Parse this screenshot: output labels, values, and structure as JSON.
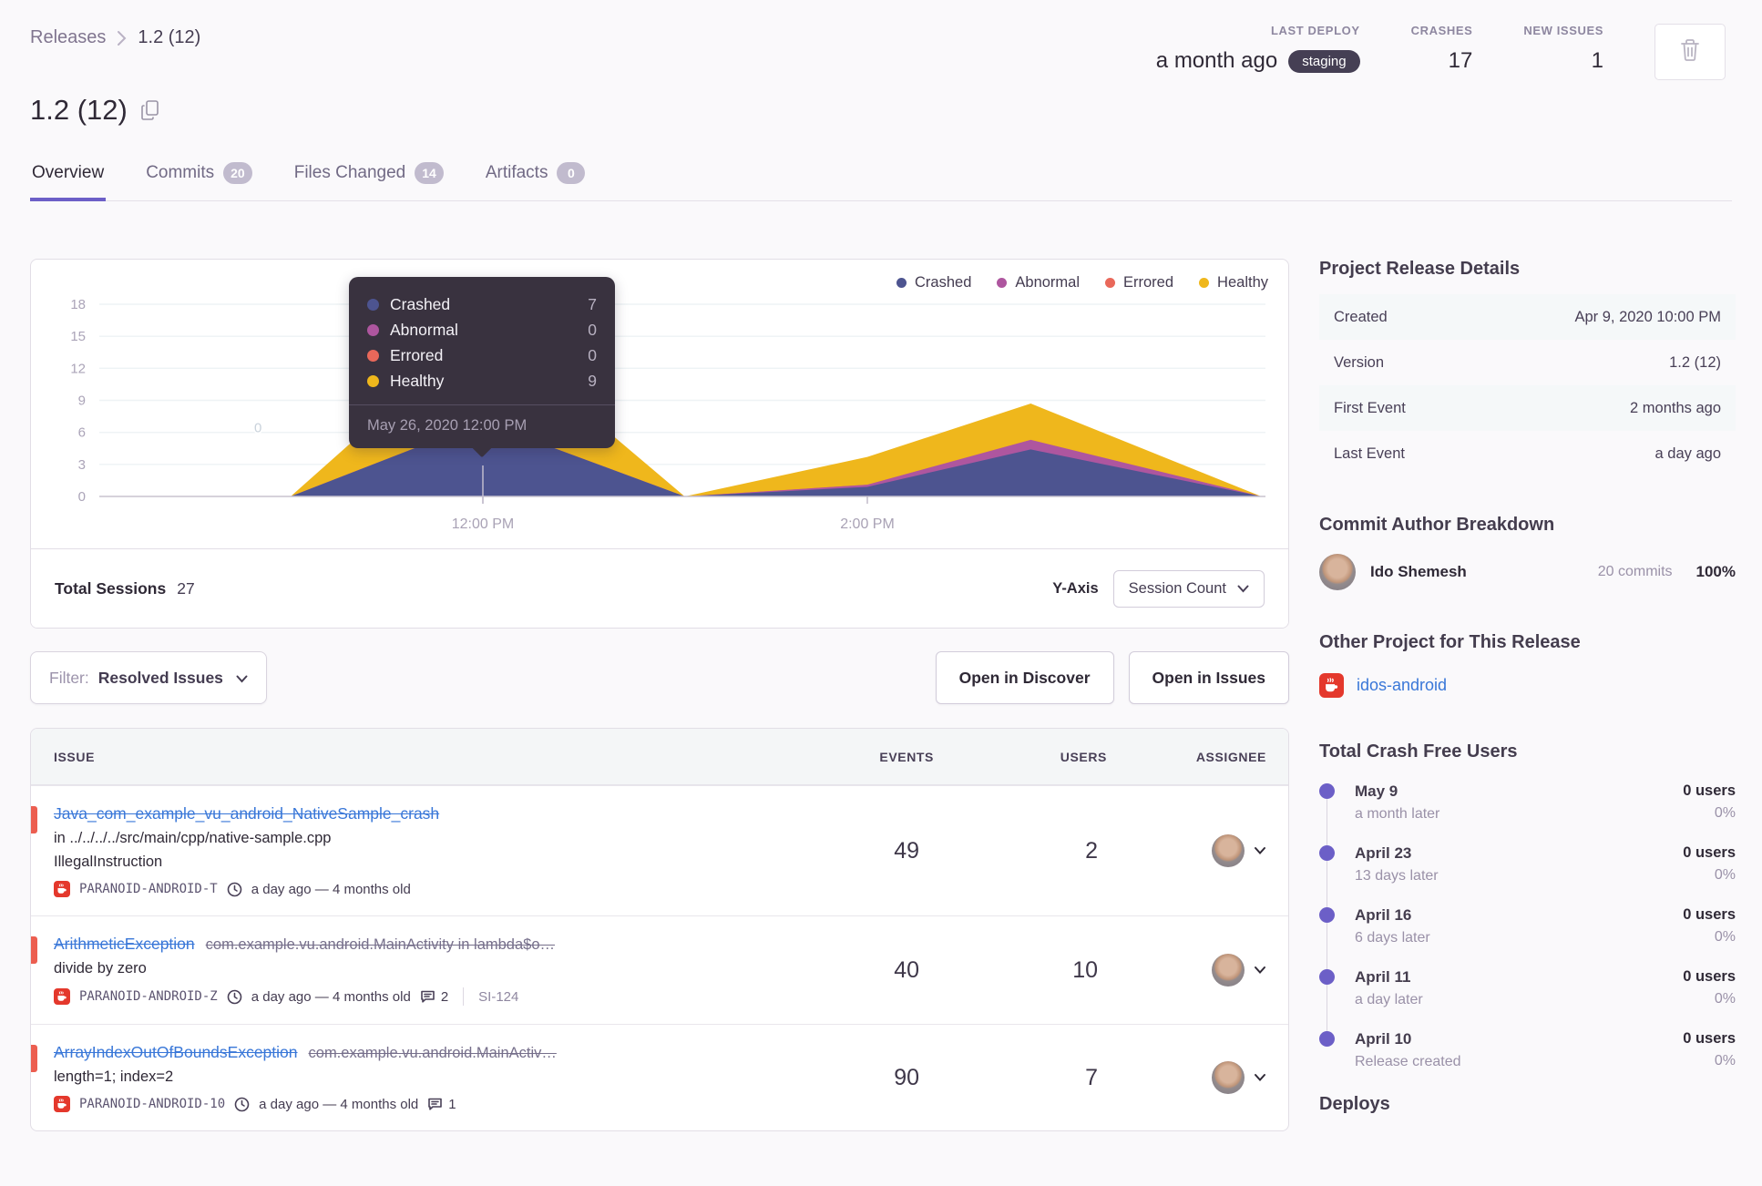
{
  "colors": {
    "accent": "#6C5FC7",
    "link_blue": "#3977D8",
    "unhandled_red": "#EC5E50",
    "env_pill_bg": "#453F54",
    "tooltip_bg": "#39323F",
    "crashed": "#4D5490",
    "abnormal": "#AE569F",
    "errored": "#E9685A",
    "healthy": "#EFB71C"
  },
  "breadcrumb": {
    "root": "Releases",
    "current": "1.2 (12)"
  },
  "header": {
    "title": "1.2 (12)",
    "stats": [
      {
        "label": "LAST DEPLOY",
        "value": "a month ago",
        "pill": "staging"
      },
      {
        "label": "CRASHES",
        "value": "17"
      },
      {
        "label": "NEW ISSUES",
        "value": "1"
      }
    ]
  },
  "tabs": [
    {
      "label": "Overview",
      "active": true
    },
    {
      "label": "Commits",
      "badge": "20"
    },
    {
      "label": "Files Changed",
      "badge": "14"
    },
    {
      "label": "Artifacts",
      "badge": "0"
    }
  ],
  "chart_data": {
    "type": "area",
    "stacked": true,
    "title": "Release session health over time",
    "x_unit": "hour of day (May 26, 2020)",
    "xticks": [
      {
        "label": "12:00 PM",
        "hour": 12
      },
      {
        "label": "2:00 PM",
        "hour": 14
      }
    ],
    "yticks": [
      0,
      3,
      6,
      9,
      12,
      15,
      18
    ],
    "ylim": [
      0,
      18
    ],
    "grid": true,
    "legend_position": "top-right",
    "x_hours": [
      10,
      11,
      12,
      13.05,
      14,
      14.85,
      16.05
    ],
    "series": [
      {
        "name": "Crashed",
        "color": "#4D5490",
        "values": [
          0,
          0,
          7,
          0,
          0.9,
          4.4,
          0
        ]
      },
      {
        "name": "Abnormal",
        "color": "#AE569F",
        "values": [
          0,
          0,
          0,
          0,
          0.2,
          0.9,
          0
        ]
      },
      {
        "name": "Errored",
        "color": "#E9685A",
        "values": [
          0,
          0,
          0,
          0,
          0,
          0,
          0
        ]
      },
      {
        "name": "Healthy",
        "color": "#EFB71C",
        "values": [
          0,
          0,
          9,
          0,
          2.6,
          3.4,
          0
        ]
      }
    ],
    "annotations": [
      {
        "text": "0",
        "hour": 10.83,
        "value": 6.0
      }
    ]
  },
  "chart_card": {
    "tooltip": {
      "rows": [
        {
          "name": "Crashed",
          "value": "7",
          "color": "#4D5490"
        },
        {
          "name": "Abnormal",
          "value": "0",
          "color": "#AE569F"
        },
        {
          "name": "Errored",
          "value": "0",
          "color": "#E9685A"
        },
        {
          "name": "Healthy",
          "value": "9",
          "color": "#EFB71C"
        }
      ],
      "date": "May 26, 2020 12:00 PM"
    },
    "total_sessions_label": "Total Sessions",
    "total_sessions_value": "27",
    "yaxis_label": "Y-Axis",
    "yaxis_value": "Session Count"
  },
  "filter": {
    "prefix": "Filter:",
    "value": "Resolved Issues"
  },
  "actions": {
    "discover": "Open in Discover",
    "issues": "Open in Issues"
  },
  "issues": {
    "headers": {
      "issue": "ISSUE",
      "events": "EVENTS",
      "users": "USERS",
      "assignee": "ASSIGNEE"
    },
    "rows": [
      {
        "title": "Java_com_example_vu_android_NativeSample_crash",
        "subtitle1": "in ../../../../src/main/cpp/native-sample.cpp",
        "subtitle2": "IllegalInstruction",
        "project": "PARANOID-ANDROID-T",
        "age": "a day ago — 4 months old",
        "events": "49",
        "users": "2"
      },
      {
        "title": "ArithmeticException",
        "culprit": "com.example.vu.android.MainActivity in lambda$o…",
        "subtitle1": "divide by zero",
        "project": "PARANOID-ANDROID-Z",
        "age": "a day ago — 4 months old",
        "comments": "2",
        "ref": "SI-124",
        "events": "40",
        "users": "10"
      },
      {
        "title": "ArrayIndexOutOfBoundsException",
        "culprit": "com.example.vu.android.MainActiv…",
        "subtitle1": "length=1; index=2",
        "project": "PARANOID-ANDROID-10",
        "age": "a day ago — 4 months old",
        "comments": "1",
        "events": "90",
        "users": "7"
      }
    ]
  },
  "sidebar": {
    "release_details": {
      "heading": "Project Release Details",
      "rows": [
        {
          "label": "Created",
          "value": "Apr 9, 2020 10:00 PM"
        },
        {
          "label": "Version",
          "value": "1.2 (12)"
        },
        {
          "label": "First Event",
          "value": "2 months ago"
        },
        {
          "label": "Last Event",
          "value": "a day ago"
        }
      ]
    },
    "author_breakdown": {
      "heading": "Commit Author Breakdown",
      "name": "Ido Shemesh",
      "commits": "20 commits",
      "percent": "100%"
    },
    "other_project": {
      "heading": "Other Project for This Release",
      "project": "idos-android"
    },
    "crash_free": {
      "heading": "Total Crash Free Users",
      "items": [
        {
          "date": "May 9",
          "sub": "a month later",
          "users": "0 users",
          "pct": "0%"
        },
        {
          "date": "April 23",
          "sub": "13 days later",
          "users": "0 users",
          "pct": "0%"
        },
        {
          "date": "April 16",
          "sub": "6 days later",
          "users": "0 users",
          "pct": "0%"
        },
        {
          "date": "April 11",
          "sub": "a day later",
          "users": "0 users",
          "pct": "0%"
        },
        {
          "date": "April 10",
          "sub": "Release created",
          "users": "0 users",
          "pct": "0%"
        }
      ]
    },
    "deploys_heading": "Deploys"
  }
}
